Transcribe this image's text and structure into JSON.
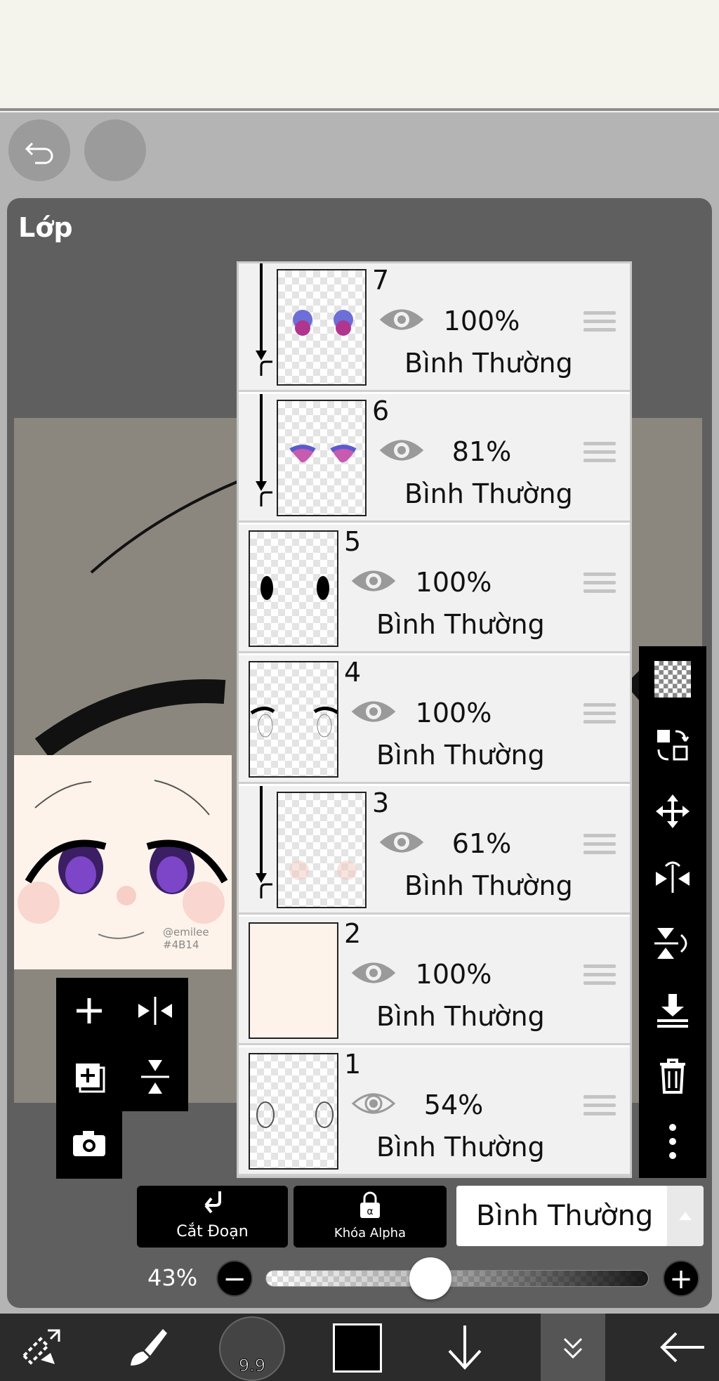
{
  "panel": {
    "title": "Lớp"
  },
  "layers": [
    {
      "num": "7",
      "opacity": "100%",
      "mode": "Bình Thường",
      "visible": true,
      "clipped": true
    },
    {
      "num": "6",
      "opacity": "81%",
      "mode": "Bình Thường",
      "visible": true,
      "clipped": true
    },
    {
      "num": "5",
      "opacity": "100%",
      "mode": "Bình Thường",
      "visible": true,
      "clipped": false
    },
    {
      "num": "4",
      "opacity": "100%",
      "mode": "Bình Thường",
      "visible": true,
      "clipped": false
    },
    {
      "num": "3",
      "opacity": "61%",
      "mode": "Bình Thường",
      "visible": true,
      "clipped": true
    },
    {
      "num": "2",
      "opacity": "100%",
      "mode": "Bình Thường",
      "visible": true,
      "clipped": false
    },
    {
      "num": "1",
      "opacity": "54%",
      "mode": "Bình Thường",
      "visible": false,
      "clipped": false
    }
  ],
  "layer_actions": {
    "clipping_label": "Cắt Đoạn",
    "alpha_lock_label": "Khóa Alpha"
  },
  "blend_mode": {
    "selected": "Bình Thường"
  },
  "opacity": {
    "label": "43%",
    "value": 0.43
  },
  "preview": {
    "signature": "@emilee #4B14"
  },
  "brush": {
    "size": "9.9"
  },
  "colors": {
    "panel_bg": "#5f5f5f",
    "primary_color": "#000000",
    "toolbar_bg": "#2b2b2b"
  },
  "icons": {
    "top": [
      "undo-icon",
      "redo-icon"
    ],
    "left_tools": [
      "add-layer-icon",
      "flip-horizontal-icon",
      "add-layer-copy-icon",
      "flip-vertical-icon",
      "camera-icon"
    ],
    "right_tools": [
      "transparent-icon",
      "swap-icon",
      "move-icon",
      "flip-horizontal-icon",
      "flip-vertical-icon",
      "merge-down-icon",
      "trash-icon",
      "more-icon"
    ],
    "bottom": [
      "selection-tool-icon",
      "brush-icon",
      "down-arrow-icon",
      "collapse-icon",
      "back-arrow-icon"
    ]
  }
}
